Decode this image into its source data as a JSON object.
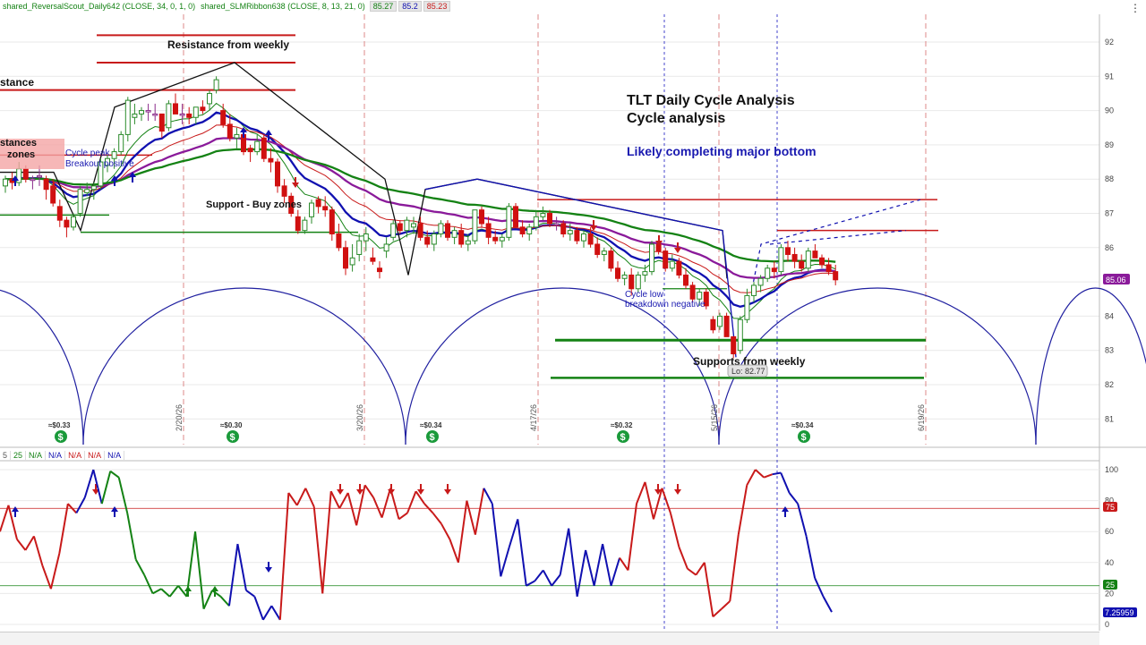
{
  "legend": {
    "item1_label": "shared_ReversalScout_Daily642 (CLOSE, 34, 0, 1, 0)",
    "item2_label": "shared_SLMRibbon638 (CLOSE, 8, 13, 21, 0)",
    "item2_values": [
      "85.27",
      "85.2",
      "85.23"
    ]
  },
  "indicator_legend": [
    "5",
    "25",
    "N/A",
    "N/A",
    "N/A",
    "N/A",
    "N/A"
  ],
  "menu_icon": "more-vertical-icon",
  "annotations": {
    "title_line1": "TLT Daily Cycle Analysis",
    "title_line2": "Cycle analysis",
    "subtitle": "Likely completing major bottom",
    "resistance_weekly": "Resistance from weekly",
    "resistance_left": "stance",
    "resistances_zones_1": "stances",
    "resistances_zones_2": "zones",
    "cycle_peak_1": "Cycle peak",
    "cycle_peak_2": "Breakout positive",
    "support_buy": "Support - Buy zones",
    "cycle_low_1": "Cycle low",
    "cycle_low_2": "breakdown negative",
    "supports_weekly": "Supports from weekly",
    "lo_label": "Lo: 82.77",
    "price_badge": "85.06",
    "osc_badge": "7.25959",
    "osc_75_badge": "75",
    "osc_25_badge": "25"
  },
  "dates": [
    "2/20/26",
    "3/20/26",
    "4/17/26",
    "5/15/26",
    "6/19/26"
  ],
  "dividends": [
    "≈$0.33",
    "≈$0.30",
    "≈$0.34",
    "≈$0.32",
    "≈$0.34"
  ],
  "colors": {
    "up": "#2a8a2a",
    "down": "#d01010",
    "neutral": "#8a2a8a",
    "blue": "#1010b0",
    "green": "#148214",
    "red": "#c81a1a",
    "purple": "#8a1a9a",
    "cycle": "#2020a0",
    "grid": "#e9e9e9"
  },
  "chart_data": {
    "type": "candlestick",
    "title": "TLT Daily Cycle Analysis",
    "subtitle": "Cycle analysis",
    "y_ticks": [
      81,
      82,
      83,
      84,
      85,
      86,
      87,
      88,
      89,
      90,
      91,
      92
    ],
    "ylim": [
      80.3,
      92.6
    ],
    "osc_ticks": [
      0,
      20,
      40,
      60,
      80,
      100
    ],
    "osc_levels": [
      75,
      25
    ],
    "osc_last": 7.25959,
    "last_price": 85.06,
    "low_price": 82.77,
    "ohlc": [
      [
        87.8,
        88.1,
        87.6,
        88.0
      ],
      [
        88.0,
        88.2,
        87.7,
        87.9
      ],
      [
        87.9,
        88.5,
        87.8,
        88.3
      ],
      [
        88.3,
        88.4,
        87.9,
        88.0
      ],
      [
        88.0,
        88.1,
        87.7,
        88.0
      ],
      [
        88.1,
        88.4,
        87.8,
        88.1
      ],
      [
        88.0,
        88.1,
        87.4,
        87.7
      ],
      [
        87.8,
        88.0,
        87.2,
        87.3
      ],
      [
        87.2,
        87.4,
        86.6,
        86.8
      ],
      [
        86.8,
        86.9,
        86.3,
        86.6
      ],
      [
        86.6,
        87.0,
        86.5,
        86.9
      ],
      [
        87.0,
        87.8,
        86.9,
        87.7
      ],
      [
        87.6,
        87.9,
        87.5,
        87.7
      ],
      [
        87.7,
        87.9,
        87.4,
        87.8
      ],
      [
        87.8,
        88.6,
        87.7,
        88.5
      ],
      [
        88.4,
        88.7,
        88.2,
        88.6
      ],
      [
        88.6,
        88.9,
        88.3,
        88.8
      ],
      [
        88.8,
        89.4,
        88.7,
        89.3
      ],
      [
        89.3,
        90.4,
        89.1,
        90.3
      ],
      [
        89.8,
        90.2,
        89.6,
        89.9
      ],
      [
        89.9,
        90.1,
        89.7,
        90.0
      ],
      [
        90.0,
        90.2,
        89.7,
        90.0
      ],
      [
        89.9,
        90.2,
        89.7,
        89.9
      ],
      [
        89.9,
        89.9,
        89.2,
        89.4
      ],
      [
        89.5,
        90.3,
        89.4,
        90.2
      ],
      [
        90.2,
        90.5,
        89.9,
        89.9
      ],
      [
        89.9,
        90.2,
        89.6,
        89.9
      ],
      [
        89.9,
        90.1,
        89.6,
        89.8
      ],
      [
        89.8,
        90.1,
        89.6,
        90.1
      ],
      [
        90.1,
        90.3,
        89.9,
        90.0
      ],
      [
        90.2,
        90.6,
        90.0,
        90.5
      ],
      [
        90.6,
        91.0,
        90.5,
        90.9
      ],
      [
        90.0,
        90.2,
        89.5,
        89.6
      ],
      [
        89.6,
        89.9,
        89.1,
        89.2
      ],
      [
        89.2,
        89.5,
        88.9,
        89.3
      ],
      [
        89.3,
        89.5,
        88.7,
        88.8
      ],
      [
        88.9,
        89.0,
        88.5,
        88.8
      ],
      [
        88.8,
        89.3,
        88.7,
        89.1
      ],
      [
        89.2,
        89.3,
        88.5,
        88.6
      ],
      [
        88.6,
        88.9,
        88.2,
        88.5
      ],
      [
        88.5,
        88.6,
        87.6,
        87.8
      ],
      [
        87.8,
        88.0,
        87.3,
        87.5
      ],
      [
        87.5,
        87.6,
        86.9,
        87.0
      ],
      [
        86.9,
        87.1,
        86.4,
        86.5
      ],
      [
        86.5,
        86.9,
        86.4,
        86.8
      ],
      [
        86.9,
        87.4,
        86.7,
        87.3
      ],
      [
        87.4,
        87.5,
        87.0,
        87.2
      ],
      [
        87.2,
        87.5,
        86.9,
        87.1
      ],
      [
        87.1,
        87.2,
        86.2,
        86.4
      ],
      [
        86.4,
        86.7,
        85.9,
        86.0
      ],
      [
        86.0,
        86.2,
        85.2,
        85.4
      ],
      [
        85.5,
        86.1,
        85.3,
        85.7
      ],
      [
        85.8,
        86.4,
        85.6,
        86.2
      ],
      [
        86.2,
        86.6,
        85.9,
        86.4
      ],
      [
        85.7,
        86.0,
        85.5,
        85.6
      ],
      [
        85.4,
        85.6,
        85.1,
        85.3
      ],
      [
        85.9,
        86.3,
        85.7,
        86.1
      ],
      [
        86.3,
        86.8,
        86.2,
        86.7
      ],
      [
        86.7,
        86.8,
        86.4,
        86.5
      ],
      [
        86.5,
        86.9,
        86.3,
        86.8
      ],
      [
        86.6,
        86.9,
        86.4,
        86.7
      ],
      [
        86.7,
        86.9,
        86.2,
        86.3
      ],
      [
        86.3,
        86.5,
        86.0,
        86.1
      ],
      [
        86.1,
        86.5,
        85.9,
        86.4
      ],
      [
        86.4,
        86.8,
        86.3,
        86.7
      ],
      [
        86.7,
        86.8,
        86.2,
        86.3
      ],
      [
        86.3,
        86.6,
        86.1,
        86.5
      ],
      [
        86.5,
        86.7,
        86.0,
        86.1
      ],
      [
        86.1,
        86.4,
        85.9,
        86.2
      ],
      [
        86.2,
        87.1,
        86.1,
        87.1
      ],
      [
        87.1,
        87.2,
        86.6,
        86.7
      ],
      [
        86.7,
        86.9,
        86.1,
        86.3
      ],
      [
        86.3,
        86.5,
        86.1,
        86.2
      ],
      [
        86.2,
        86.4,
        86.0,
        86.3
      ],
      [
        86.3,
        87.3,
        86.2,
        87.2
      ],
      [
        87.2,
        87.3,
        86.6,
        86.6
      ],
      [
        86.6,
        86.8,
        86.3,
        86.4
      ],
      [
        86.4,
        86.7,
        86.2,
        86.6
      ],
      [
        86.6,
        87.1,
        86.5,
        86.9
      ],
      [
        86.9,
        87.2,
        86.8,
        87.0
      ],
      [
        87.0,
        87.1,
        86.6,
        86.7
      ],
      [
        86.7,
        86.9,
        86.5,
        86.7
      ],
      [
        86.7,
        86.8,
        86.3,
        86.4
      ],
      [
        86.4,
        86.7,
        86.2,
        86.5
      ],
      [
        86.5,
        86.6,
        86.1,
        86.2
      ],
      [
        86.2,
        86.5,
        86.0,
        86.4
      ],
      [
        86.4,
        86.6,
        86.0,
        86.1
      ],
      [
        86.1,
        86.3,
        85.7,
        85.8
      ],
      [
        85.8,
        86.0,
        85.6,
        85.9
      ],
      [
        85.9,
        86.0,
        85.3,
        85.4
      ],
      [
        85.4,
        85.6,
        85.0,
        85.1
      ],
      [
        85.1,
        85.3,
        84.9,
        85.2
      ],
      [
        85.2,
        85.4,
        84.6,
        84.8
      ],
      [
        84.8,
        85.3,
        84.7,
        85.2
      ],
      [
        85.2,
        85.5,
        85.0,
        85.3
      ],
      [
        85.3,
        86.2,
        85.2,
        86.1
      ],
      [
        86.1,
        86.3,
        85.8,
        85.9
      ],
      [
        85.9,
        86.0,
        85.3,
        85.4
      ],
      [
        85.4,
        85.8,
        85.3,
        85.6
      ],
      [
        85.6,
        85.7,
        85.1,
        85.2
      ],
      [
        85.2,
        85.4,
        84.8,
        84.9
      ],
      [
        84.9,
        85.0,
        84.4,
        84.5
      ],
      [
        84.5,
        84.8,
        84.3,
        84.7
      ],
      [
        84.7,
        84.8,
        84.2,
        84.3
      ],
      [
        83.9,
        84.0,
        83.5,
        83.6
      ],
      [
        83.7,
        84.1,
        83.6,
        84.0
      ],
      [
        84.0,
        84.1,
        83.4,
        83.4
      ],
      [
        83.4,
        83.4,
        82.77,
        82.9
      ],
      [
        83.0,
        84.0,
        82.9,
        83.9
      ],
      [
        83.9,
        84.8,
        83.8,
        84.6
      ],
      [
        84.6,
        85.0,
        84.4,
        84.9
      ],
      [
        84.9,
        85.2,
        84.7,
        85.1
      ],
      [
        85.1,
        85.5,
        85.0,
        85.4
      ],
      [
        85.4,
        85.6,
        85.1,
        85.3
      ],
      [
        85.3,
        86.1,
        85.2,
        86.0
      ],
      [
        86.0,
        86.2,
        85.6,
        85.8
      ],
      [
        85.8,
        86.0,
        85.4,
        85.6
      ],
      [
        85.6,
        85.8,
        85.3,
        85.4
      ],
      [
        85.4,
        86.0,
        85.3,
        85.9
      ],
      [
        85.9,
        86.1,
        85.7,
        85.7
      ],
      [
        85.7,
        85.8,
        85.4,
        85.5
      ],
      [
        85.5,
        85.7,
        85.2,
        85.3
      ],
      [
        85.3,
        85.5,
        84.9,
        85.06
      ]
    ],
    "osc_values": [
      60,
      77,
      55,
      48,
      57,
      38,
      23,
      46,
      78,
      72,
      82,
      100,
      78,
      99,
      95,
      72,
      42,
      32,
      20,
      23,
      18,
      25,
      18,
      60,
      10,
      22,
      18,
      12,
      52,
      22,
      18,
      3,
      12,
      3,
      85,
      77,
      88,
      76,
      20,
      86,
      75,
      85,
      64,
      90,
      82,
      69,
      88,
      68,
      72,
      86,
      78,
      72,
      65,
      55,
      40,
      80,
      58,
      88,
      78,
      31,
      50,
      68,
      25,
      28,
      35,
      25,
      32,
      62,
      18,
      48,
      25,
      52,
      25,
      43,
      35,
      78,
      92,
      68,
      88,
      72,
      50,
      36,
      32,
      40,
      5,
      10,
      15,
      58,
      90,
      100,
      95,
      97,
      98,
      85,
      78,
      57,
      30,
      18,
      8
    ]
  }
}
